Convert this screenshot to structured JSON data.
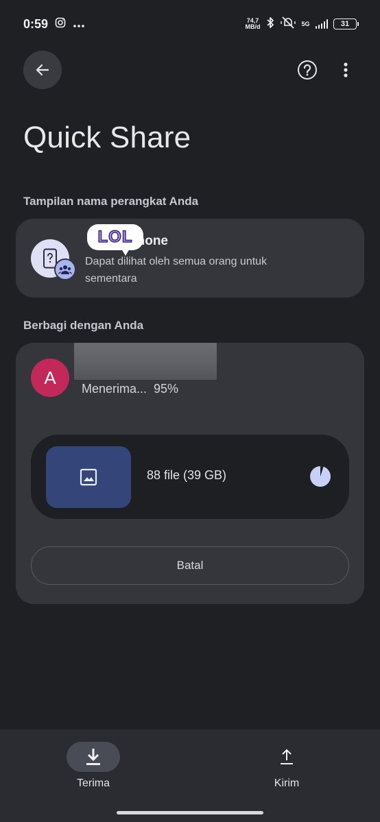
{
  "status_bar": {
    "time": "0:59",
    "net_speed_value": "74,7",
    "net_speed_unit": "MB/d",
    "network": "5G",
    "battery": "31",
    "icons": [
      "instagram-icon",
      "more-dots-icon",
      "bluetooth-icon",
      "mute-vibrate-icon",
      "signal-icon",
      "battery-icon"
    ]
  },
  "app_bar": {
    "back_icon": "arrow-back-icon",
    "help_icon": "help-circle-icon",
    "menu_icon": "more-vert-icon"
  },
  "title": "Quick Share",
  "device_section": {
    "label": "Tampilan nama perangkat Anda",
    "device_name_visible": "phone",
    "visibility_text": "Dapat dilihat oleh semua orang untuk sementara",
    "sticker_text": "LOL",
    "icons": [
      "phone-question-icon",
      "group-icon"
    ]
  },
  "shared_section": {
    "label": "Berbagi dengan Anda",
    "sender_initial": "A",
    "status": "Menerima...  95%",
    "progress_percent": 95,
    "file_summary": "88 file (39 GB)",
    "cancel_label": "Batal",
    "colors": {
      "avatar": "#c2285a",
      "thumb": "#34457a",
      "progress": "#c7d0f7"
    }
  },
  "bottom_nav": {
    "items": [
      {
        "label": "Terima",
        "icon": "download-icon",
        "active": true
      },
      {
        "label": "Kirim",
        "icon": "upload-icon",
        "active": false
      }
    ]
  }
}
